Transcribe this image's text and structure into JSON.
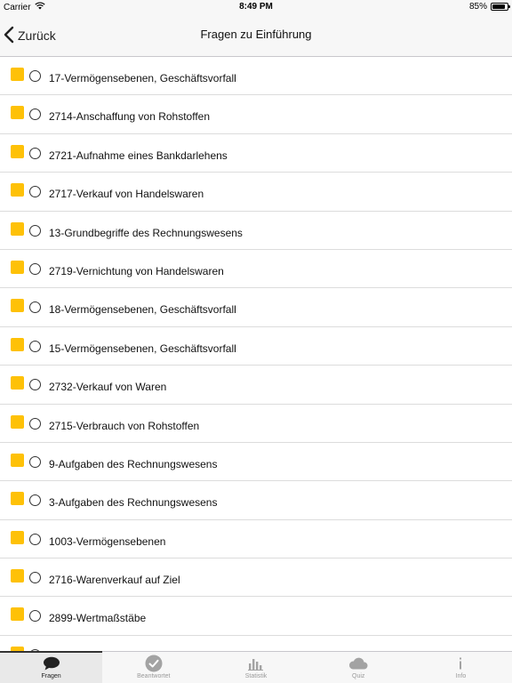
{
  "status_bar": {
    "carrier": "Carrier",
    "time": "8:49 PM",
    "battery": "85%",
    "battery_level": 0.85
  },
  "nav": {
    "back_label": "Zurück",
    "title": "Fragen zu Einführung"
  },
  "colors": {
    "flag": "#fec107",
    "tab_active": "#222222",
    "tab_inactive": "#9a9a9a"
  },
  "list": {
    "items": [
      {
        "label": "17-Vermögensebenen, Geschäftsvorfall"
      },
      {
        "label": "2714-Anschaffung von Rohstoffen"
      },
      {
        "label": "2721-Aufnahme eines Bankdarlehens"
      },
      {
        "label": "2717-Verkauf von Handelswaren"
      },
      {
        "label": "13-Grundbegriffe des Rechnungswesens"
      },
      {
        "label": "2719-Vernichtung von Handelswaren"
      },
      {
        "label": "18-Vermögensebenen, Geschäftsvorfall"
      },
      {
        "label": "15-Vermögensebenen, Geschäftsvorfall"
      },
      {
        "label": "2732-Verkauf von Waren"
      },
      {
        "label": "2715-Verbrauch von Rohstoffen"
      },
      {
        "label": "9-Aufgaben des Rechnungswesens"
      },
      {
        "label": "3-Aufgaben des Rechnungswesens"
      },
      {
        "label": "1003-Vermögensebenen"
      },
      {
        "label": "2716-Warenverkauf auf Ziel"
      },
      {
        "label": "2899-Wertmaßstäbe"
      },
      {
        "label": ""
      }
    ]
  },
  "tabbar": {
    "tabs": [
      {
        "label": "Fragen",
        "icon": "speech-bubble-icon",
        "active": true
      },
      {
        "label": "Beantwortet",
        "icon": "checkmark-circle-icon",
        "active": false
      },
      {
        "label": "Statistik",
        "icon": "bar-chart-icon",
        "active": false
      },
      {
        "label": "Quiz",
        "icon": "cloud-icon",
        "active": false
      },
      {
        "label": "Info",
        "icon": "info-icon",
        "active": false
      }
    ]
  }
}
